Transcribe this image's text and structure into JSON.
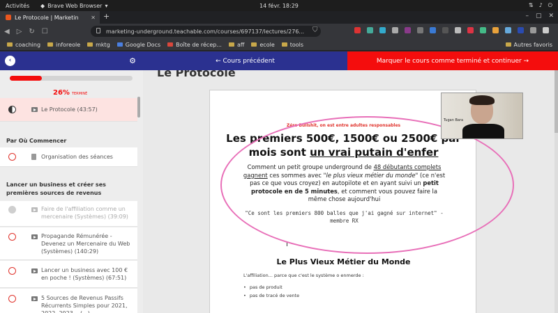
{
  "os": {
    "activities": "Activités",
    "app_name": "Brave Web Browser",
    "clock": "14 févr.  18:29"
  },
  "browser": {
    "tab_title": "Le Protocole | Marketin",
    "url": "marketing-underground.teachable.com/courses/697137/lectures/276...",
    "bookmarks": [
      "coaching",
      "inforeole",
      "mktg",
      "Google Docs",
      "Boîte de récep...",
      "aff",
      "ecole",
      "tools"
    ],
    "other_bookmarks": "Autres favoris"
  },
  "course_nav": {
    "prev_label": "← Cours précédent",
    "complete_label": "Marquer le cours comme terminé et continuer →"
  },
  "sidebar": {
    "progress": 0.26,
    "percent": "26%",
    "percent_suffix": "TERMINÉ",
    "current_lesson": "Le Protocole (43:57)",
    "sections": [
      {
        "title": "Par Où Commencer",
        "lessons": [
          {
            "label": "Organisation des séances",
            "type": "text",
            "status": "todo"
          }
        ]
      },
      {
        "title": "Lancer un business et créer ses premières sources de revenus",
        "lessons": [
          {
            "label": "Faire de l'affiliation comme un mercenaire (Systèmes) (39:09)",
            "type": "video",
            "status": "done"
          },
          {
            "label": "Propagande Rémunérée - Devenez un Mercenaire du Web (Systèmes) (140:29)",
            "type": "video",
            "status": "todo"
          },
          {
            "label": "Lancer un business avec 100 € en poche ! (Systèmes) (67:51)",
            "type": "video",
            "status": "todo"
          },
          {
            "label": "5 Sources de Revenus Passifs Récurrents Simples pour 2021, 2022, 2023... (...)",
            "type": "video",
            "status": "todo"
          }
        ]
      }
    ]
  },
  "content": {
    "ghost_title": "Le Protocole",
    "tagline": "Zéro Bullshit, on est entre adultes responsables",
    "headline_part1": "Les premiers 500€, 1500€ ou 2500€ par mois sont ",
    "headline_underlined": "un vrai putain d'enfer",
    "para_line1a": "Comment un petit groupe underground de ",
    "para_line1b": "48 débutants complets gagnent",
    "para_line2a": " ces sommes avec ",
    "para_italic": "\"le plus vieux métier du monde\"",
    "para_line2b": " (ce n'est pas ce que vous croyez) en autopilote et en ayant suivi un ",
    "para_bold": "petit protocole en de 5 minutes",
    "para_end": ", et comment vous pouvez faire la même chose aujourd'hui",
    "quote": "\"Ce sont les premiers 800 balles que j'ai gagné sur internet\" - membre RX",
    "section_title": "Le Plus Vieux Métier du Monde",
    "section_intro": "L'affiliation... parce que c'est le système o enmerde :",
    "bullets": [
      "pas de produit",
      "pas de tracé de vente"
    ],
    "webcam_name": "Tugan Bara"
  },
  "colors": {
    "primary": "#2b3190",
    "accent": "#f40d0d",
    "annotation": "#e86fb8"
  }
}
